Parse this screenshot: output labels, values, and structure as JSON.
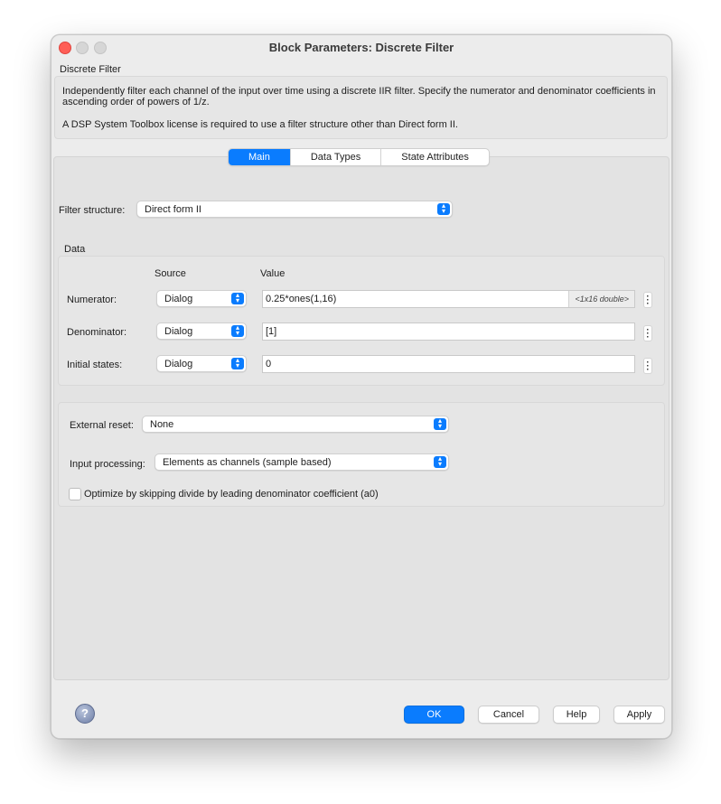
{
  "window": {
    "title": "Block Parameters: Discrete Filter"
  },
  "block": {
    "name": "Discrete Filter",
    "description_1": "Independently filter each channel of the input over time using a discrete IIR filter. Specify the numerator and denominator coefficients in ascending order of powers of 1/z.",
    "description_2": "A DSP System Toolbox license is required to use a filter structure other than Direct form II."
  },
  "tabs": [
    {
      "label": "Main",
      "active": true
    },
    {
      "label": "Data Types",
      "active": false
    },
    {
      "label": "State Attributes",
      "active": false
    }
  ],
  "filter_structure": {
    "label": "Filter structure:",
    "value": "Direct form II"
  },
  "data": {
    "group_label": "Data",
    "source_header": "Source",
    "value_header": "Value",
    "rows": [
      {
        "label": "Numerator:",
        "source": "Dialog",
        "value": "0.25*ones(1,16)",
        "hint": "<1x16 double>"
      },
      {
        "label": "Denominator:",
        "source": "Dialog",
        "value": "[1]"
      },
      {
        "label": "Initial states:",
        "source": "Dialog",
        "value": "0"
      }
    ]
  },
  "options": {
    "external_reset_label": "External reset:",
    "external_reset_value": "None",
    "input_processing_label": "Input processing:",
    "input_processing_value": "Elements as channels (sample based)",
    "optimize_label": "Optimize by skipping divide by leading denominator coefficient (a0)",
    "optimize_checked": false
  },
  "buttons": {
    "ok": "OK",
    "cancel": "Cancel",
    "help": "Help",
    "apply": "Apply"
  },
  "help_icon_glyph": "?",
  "colors": {
    "accent": "#0a7cfe",
    "close": "#ff5f57"
  }
}
